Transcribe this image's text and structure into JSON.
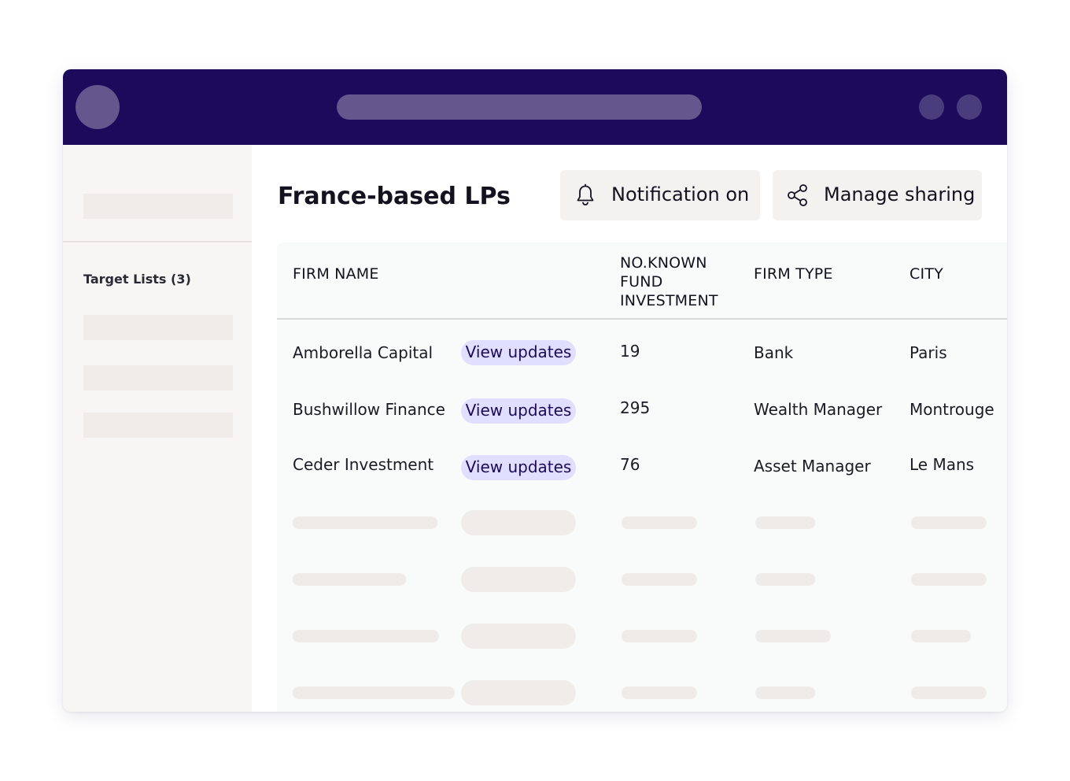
{
  "sidebar": {
    "section_label": "Target Lists (3)"
  },
  "main": {
    "title": "France-based LPs",
    "notification_button": {
      "label": "Notification on",
      "icon": "bell-icon"
    },
    "share_button": {
      "label": "Manage sharing",
      "icon": "share-icon"
    }
  },
  "table": {
    "columns": [
      "FIRM NAME",
      "NO.KNOWN FUND INVESTMENT",
      "FIRM TYPE",
      "CITY"
    ],
    "column_lines": {
      "investment": [
        "NO.KNOWN",
        "FUND",
        "INVESTMENT"
      ]
    },
    "rows": [
      {
        "firm": "Amborella Capital",
        "action": "View updates",
        "investments": "19",
        "type": "Bank",
        "city": "Paris"
      },
      {
        "firm": "Bushwillow Finance",
        "action": "View updates",
        "investments": "295",
        "type": "Wealth Manager",
        "city": "Montrouge"
      },
      {
        "firm": "Ceder Investment",
        "action": "View updates",
        "investments": "76",
        "type": "Asset Manager",
        "city": "Le Mans"
      }
    ]
  },
  "colors": {
    "titlebar": "#1c0b5a",
    "pill_bg": "#e1dfff",
    "pill_text": "#1c0b5a"
  }
}
